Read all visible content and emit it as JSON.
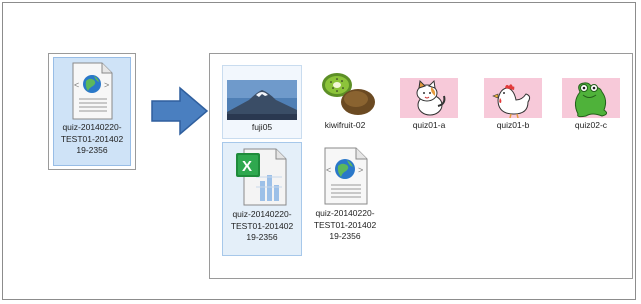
{
  "source": {
    "file_label": "quiz-20140220-\nTEST01-201402\n19-2356",
    "icon": "web-document-icon"
  },
  "arrow": {
    "icon": "right-arrow-icon",
    "color": "#4a7fc0"
  },
  "explorer": {
    "items": [
      {
        "label": "fuji05",
        "icon": "mount-fuji-photo"
      },
      {
        "label": "kiwifruit-02",
        "icon": "kiwifruit-photo"
      },
      {
        "label": "quiz01-a",
        "icon": "cat-illustration"
      },
      {
        "label": "quiz01-b",
        "icon": "chicken-illustration"
      },
      {
        "label": "quiz02-c",
        "icon": "frog-illustration"
      },
      {
        "label": "quiz-20140220-\nTEST01-201402\n19-2356",
        "icon": "excel-file-icon"
      },
      {
        "label": "quiz-20140220-\nTEST01-201402\n19-2356",
        "icon": "web-document-icon"
      }
    ]
  },
  "colors": {
    "selection": "#cfe3f7",
    "thumb_pink": "#f7c9d9",
    "excel_green": "#1f8b3b"
  }
}
